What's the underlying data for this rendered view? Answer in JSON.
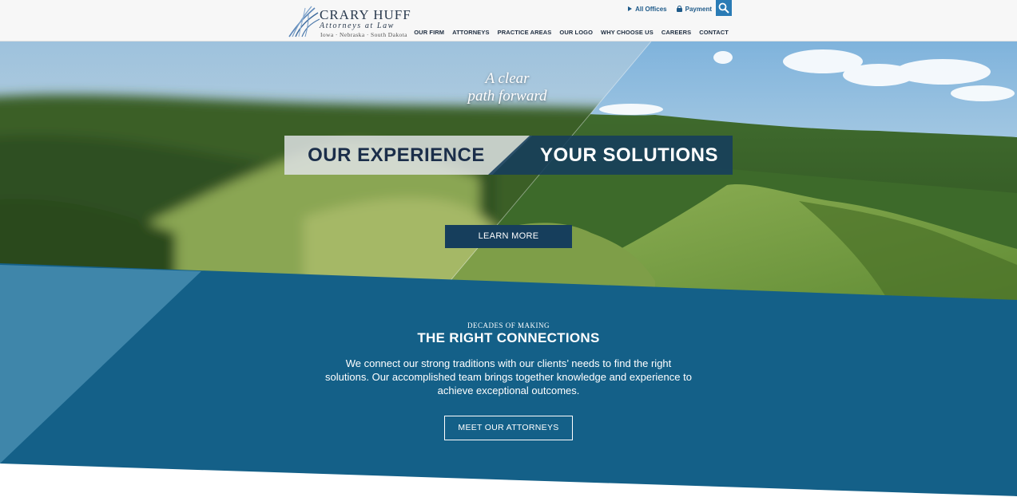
{
  "brand": {
    "name": "CRARY HUFF",
    "subtitle": "Attorneys at Law",
    "states": "Iowa · Nebraska · South Dakota"
  },
  "utility": {
    "offices_label": "All Offices",
    "payment_label": "Payment"
  },
  "nav": {
    "items": [
      "OUR FIRM",
      "ATTORNEYS",
      "PRACTICE AREAS",
      "OUR LOGO",
      "WHY CHOOSE US",
      "CAREERS",
      "CONTACT"
    ]
  },
  "hero": {
    "tagline_line1": "A clear",
    "tagline_line2": "path forward",
    "banner_left": "OUR EXPERIENCE",
    "banner_right": "YOUR SOLUTIONS",
    "cta": "LEARN MORE"
  },
  "section": {
    "kicker": "DECADES OF MAKING",
    "title": "THE RIGHT CONNECTIONS",
    "body": "We connect our strong traditions with our clients’ needs to find the right solutions. Our accomplished team brings together knowledge and experience to achieve exceptional outcomes.",
    "cta": "MEET OUR ATTORNEYS"
  },
  "colors": {
    "band_blue": "#146088",
    "band_light": "#3f86aa",
    "navy": "#163e5c",
    "search_blue": "#2a7bb5"
  },
  "icons": [
    "logo-grass-mark-icon",
    "arrow-right-icon",
    "lock-icon",
    "search-icon"
  ]
}
